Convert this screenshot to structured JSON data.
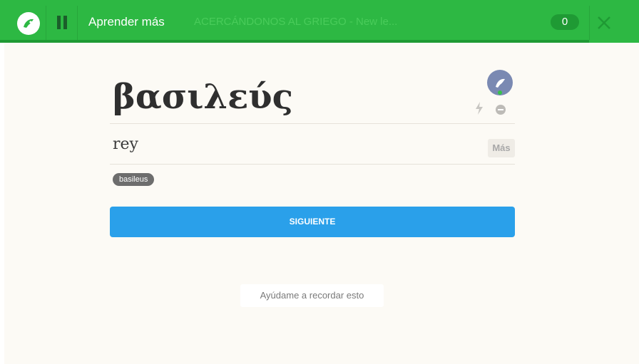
{
  "header": {
    "learn_label": "Aprender más",
    "course_title": "ACERCÁNDONOS AL GRIEGO - New le...",
    "score": "0",
    "colors": {
      "bar": "#2db843",
      "bar_dark": "#1f9a34"
    },
    "icons": {
      "logo": "memrise-logo-icon",
      "pause": "pause-icon",
      "close": "close-icon"
    }
  },
  "card": {
    "word": "βασιλεύς",
    "meaning": "rey",
    "more_label": "Más",
    "tag": "basileus",
    "icons": {
      "avatar": "mem-avatar-icon",
      "bolt": "lightning-icon",
      "ignore": "minus-circle-icon"
    }
  },
  "actions": {
    "next_label": "SIGUIENTE",
    "help_label": "Ayúdame a recordar esto",
    "next_color": "#2aa0ea"
  }
}
